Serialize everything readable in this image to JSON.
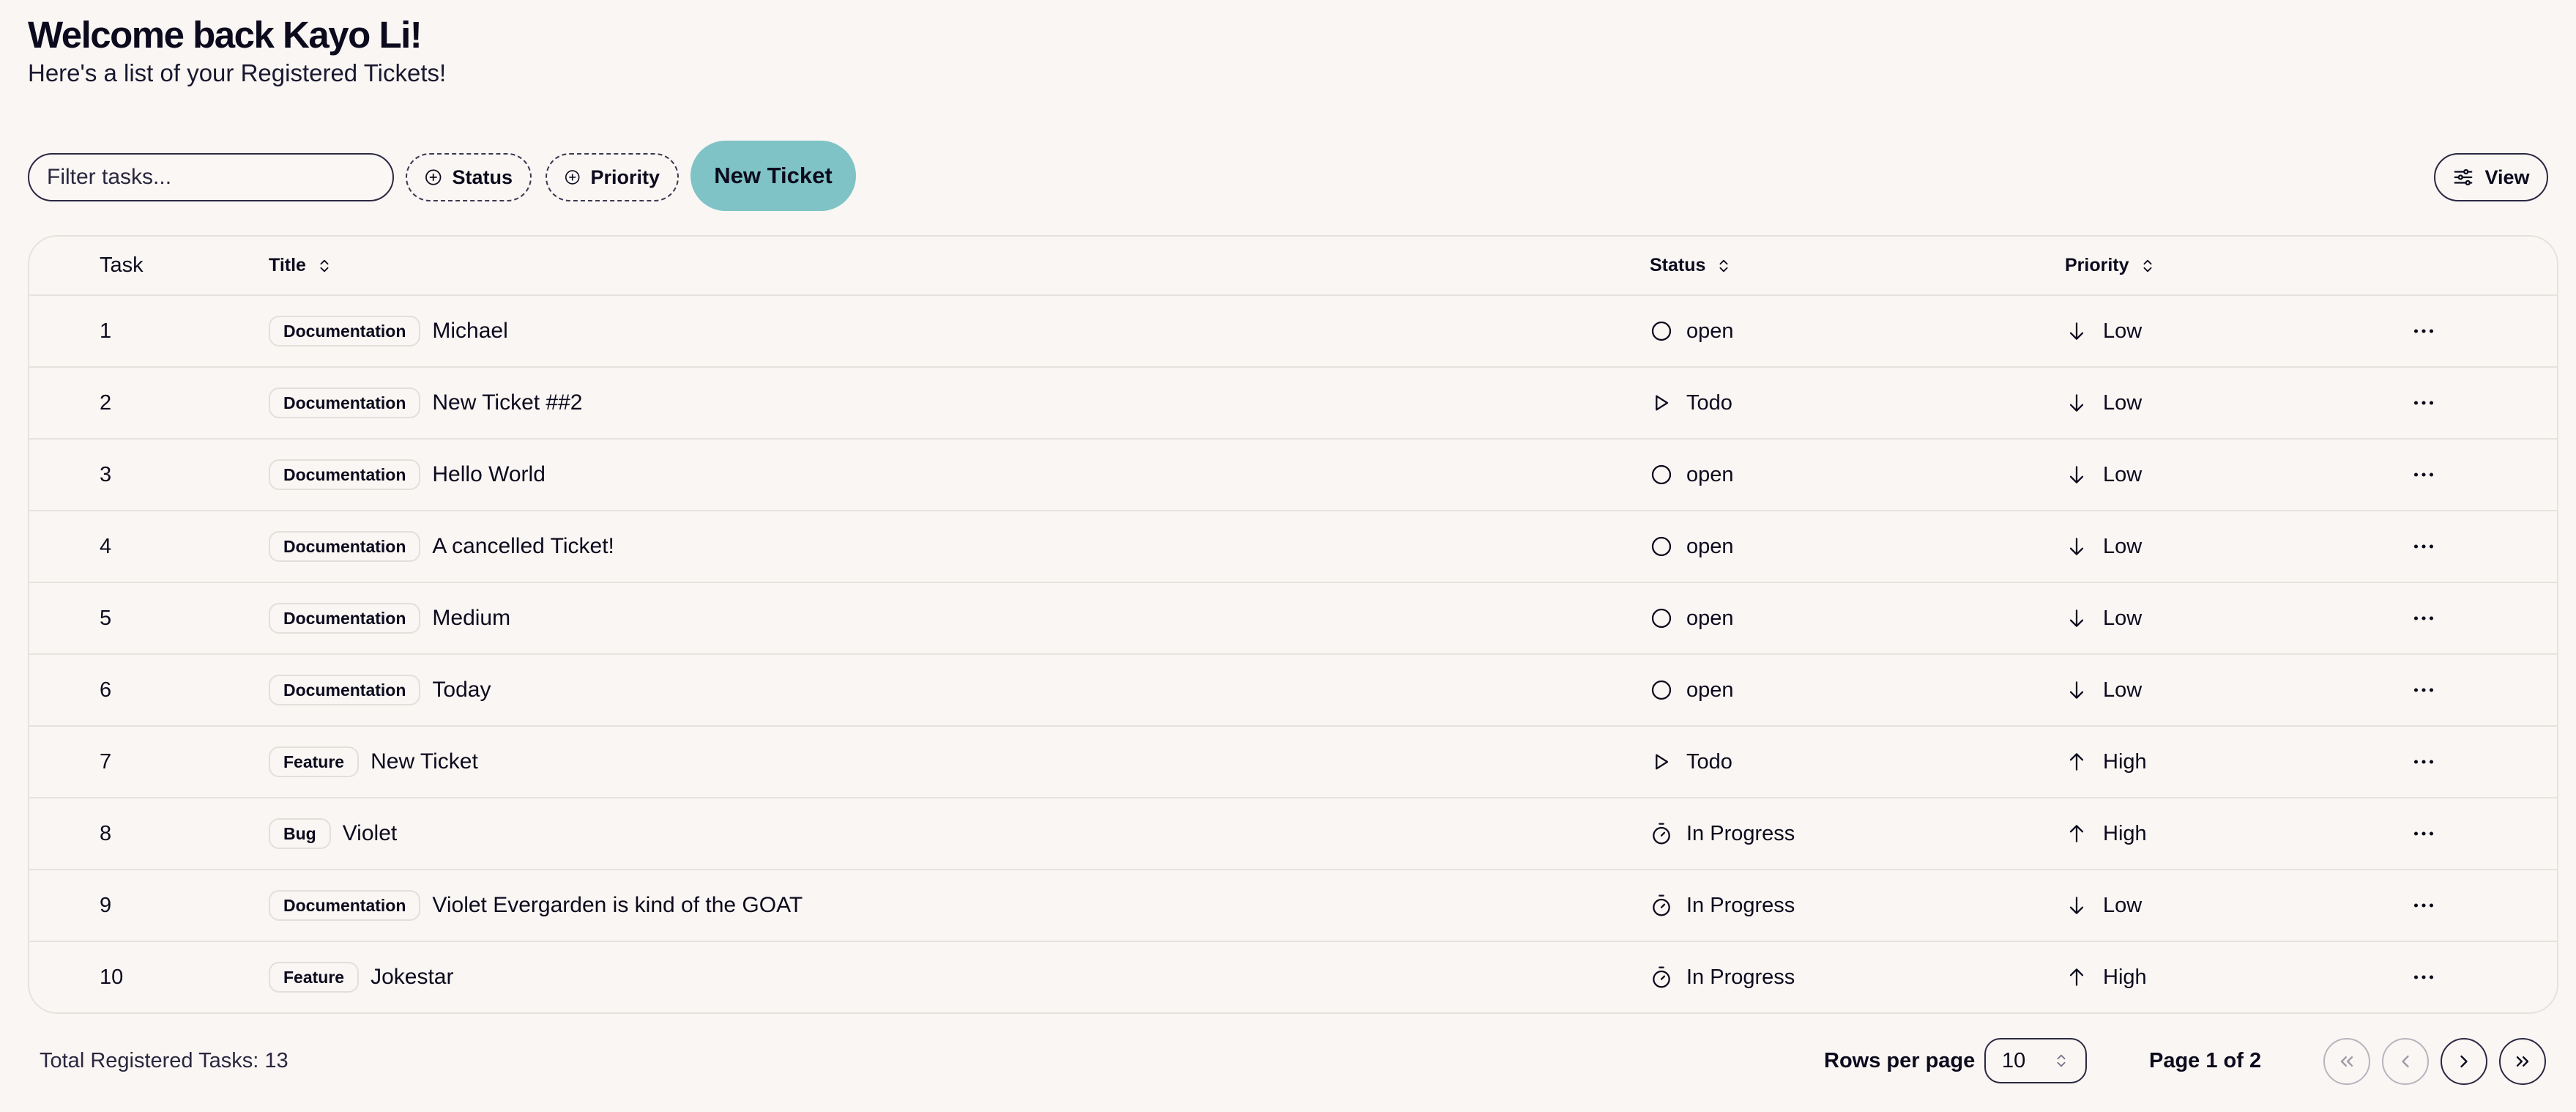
{
  "header": {
    "title": "Welcome back Kayo Li!",
    "subtitle": "Here's a list of your Registered Tickets!"
  },
  "toolbar": {
    "filter_placeholder": "Filter tasks...",
    "status_label": "Status",
    "priority_label": "Priority",
    "new_ticket_label": "New Ticket",
    "view_label": "View"
  },
  "table": {
    "columns": {
      "task": "Task",
      "title": "Title",
      "status": "Status",
      "priority": "Priority"
    },
    "rows": [
      {
        "task": "1",
        "label": "Documentation",
        "title": "Michael",
        "status": "open",
        "status_icon": "circle-icon",
        "priority": "Low",
        "priority_icon": "arrow-down-icon"
      },
      {
        "task": "2",
        "label": "Documentation",
        "title": "New Ticket ##2",
        "status": "Todo",
        "status_icon": "play-icon",
        "priority": "Low",
        "priority_icon": "arrow-down-icon"
      },
      {
        "task": "3",
        "label": "Documentation",
        "title": "Hello World",
        "status": "open",
        "status_icon": "circle-icon",
        "priority": "Low",
        "priority_icon": "arrow-down-icon"
      },
      {
        "task": "4",
        "label": "Documentation",
        "title": "A cancelled Ticket!",
        "status": "open",
        "status_icon": "circle-icon",
        "priority": "Low",
        "priority_icon": "arrow-down-icon"
      },
      {
        "task": "5",
        "label": "Documentation",
        "title": "Medium",
        "status": "open",
        "status_icon": "circle-icon",
        "priority": "Low",
        "priority_icon": "arrow-down-icon"
      },
      {
        "task": "6",
        "label": "Documentation",
        "title": "Today",
        "status": "open",
        "status_icon": "circle-icon",
        "priority": "Low",
        "priority_icon": "arrow-down-icon"
      },
      {
        "task": "7",
        "label": "Feature",
        "title": "New Ticket",
        "status": "Todo",
        "status_icon": "play-icon",
        "priority": "High",
        "priority_icon": "arrow-up-icon"
      },
      {
        "task": "8",
        "label": "Bug",
        "title": "Violet",
        "status": "In Progress",
        "status_icon": "timer-icon",
        "priority": "High",
        "priority_icon": "arrow-up-icon"
      },
      {
        "task": "9",
        "label": "Documentation",
        "title": "Violet Evergarden is kind of the GOAT",
        "status": "In Progress",
        "status_icon": "timer-icon",
        "priority": "Low",
        "priority_icon": "arrow-down-icon"
      },
      {
        "task": "10",
        "label": "Feature",
        "title": "Jokestar",
        "status": "In Progress",
        "status_icon": "timer-icon",
        "priority": "High",
        "priority_icon": "arrow-up-icon"
      }
    ]
  },
  "footer": {
    "total": "Total Registered Tasks: 13",
    "rows_per_page_label": "Rows per page",
    "rows_per_page_value": "10",
    "page_info": "Page 1 of 2"
  },
  "colors": {
    "background": "#f9f6f3",
    "accent": "#7fc3c6",
    "text": "#0c0a1d",
    "border": "#e6e2de"
  }
}
